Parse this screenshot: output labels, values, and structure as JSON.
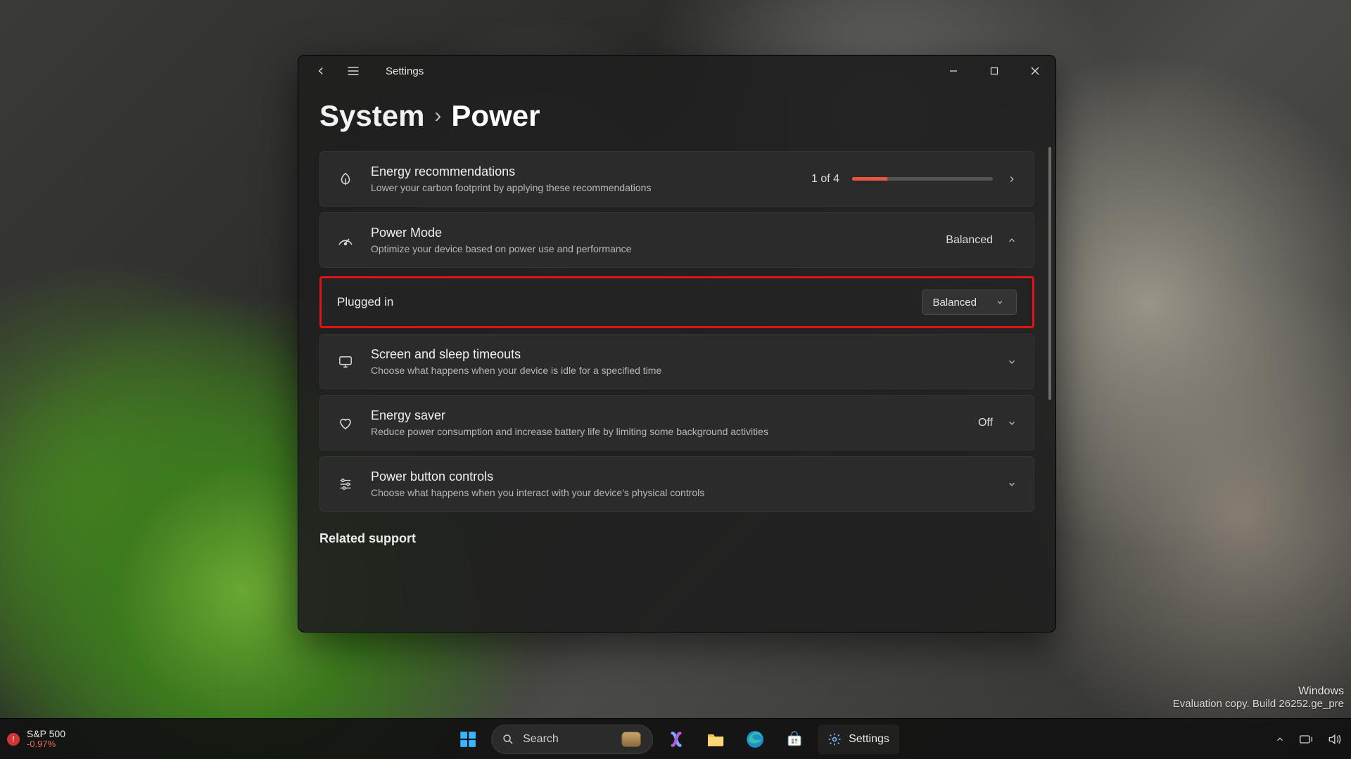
{
  "window": {
    "app_title": "Settings",
    "breadcrumb": {
      "parent": "System",
      "separator": "›",
      "page": "Power"
    }
  },
  "cards": {
    "energy": {
      "title": "Energy recommendations",
      "sub": "Lower your carbon footprint by applying these recommendations",
      "progress_label": "1 of 4"
    },
    "power_mode": {
      "title": "Power Mode",
      "sub": "Optimize your device based on power use and performance",
      "value": "Balanced"
    },
    "plugged_in": {
      "label": "Plugged in",
      "value": "Balanced"
    },
    "screen_sleep": {
      "title": "Screen and sleep timeouts",
      "sub": "Choose what happens when your device is idle for a specified time"
    },
    "energy_saver": {
      "title": "Energy saver",
      "sub": "Reduce power consumption and increase battery life by limiting some background activities",
      "value": "Off"
    },
    "power_button": {
      "title": "Power button controls",
      "sub": "Choose what happens when you interact with your device's physical controls"
    }
  },
  "related_support": "Related support",
  "watermark": {
    "line1": "Windows",
    "line2": "Evaluation copy. Build 26252.ge_pre"
  },
  "taskbar": {
    "widget": {
      "title": "S&P 500",
      "change": "-0.97%"
    },
    "search_placeholder": "Search",
    "active_app": "Settings"
  }
}
